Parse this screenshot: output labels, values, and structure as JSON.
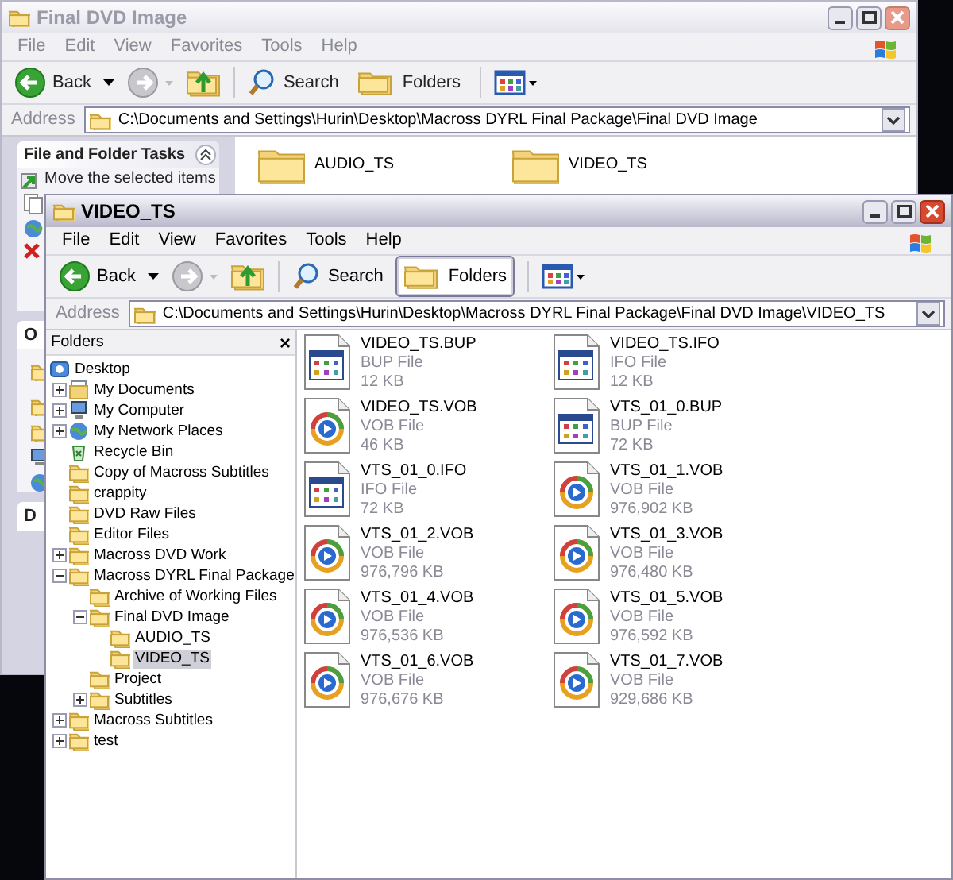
{
  "back_window": {
    "title": "Final DVD Image",
    "active": false,
    "menu": [
      "File",
      "Edit",
      "View",
      "Favorites",
      "Tools",
      "Help"
    ],
    "toolbar": {
      "back": "Back",
      "search": "Search",
      "folders": "Folders",
      "folders_pressed": false
    },
    "address": {
      "label": "Address",
      "value": "C:\\Documents and Settings\\Hurin\\Desktop\\Macross DYRL Final Package\\Final DVD Image"
    },
    "task_pane": {
      "title": "File and Folder Tasks",
      "first_task": "Move the selected items",
      "cut_headers": [
        "O",
        "D"
      ]
    },
    "items": [
      {
        "name": "AUDIO_TS"
      },
      {
        "name": "VIDEO_TS"
      }
    ]
  },
  "front_window": {
    "title": "VIDEO_TS",
    "active": true,
    "menu": [
      "File",
      "Edit",
      "View",
      "Favorites",
      "Tools",
      "Help"
    ],
    "toolbar": {
      "back": "Back",
      "search": "Search",
      "folders": "Folders",
      "folders_pressed": true
    },
    "address": {
      "label": "Address",
      "value": "C:\\Documents and Settings\\Hurin\\Desktop\\Macross DYRL Final Package\\Final DVD Image\\VIDEO_TS"
    },
    "folders_pane": {
      "title": "Folders",
      "close": "×",
      "tree": [
        {
          "label": "Desktop",
          "kind": "desktop",
          "expander": false,
          "expanded": false,
          "selected": false,
          "children": [
            {
              "label": "My Documents",
              "kind": "documents",
              "expander": true,
              "expanded": false,
              "selected": false
            },
            {
              "label": "My Computer",
              "kind": "computer",
              "expander": true,
              "expanded": false,
              "selected": false
            },
            {
              "label": "My Network Places",
              "kind": "network",
              "expander": true,
              "expanded": false,
              "selected": false
            },
            {
              "label": "Recycle Bin",
              "kind": "recycle",
              "expander": false,
              "expanded": false,
              "selected": false
            },
            {
              "label": "Copy of Macross Subtitles",
              "kind": "folder",
              "expander": false,
              "expanded": false,
              "selected": false
            },
            {
              "label": "crappity",
              "kind": "folder",
              "expander": false,
              "expanded": false,
              "selected": false
            },
            {
              "label": "DVD Raw Files",
              "kind": "folder",
              "expander": false,
              "expanded": false,
              "selected": false
            },
            {
              "label": "Editor Files",
              "kind": "folder",
              "expander": false,
              "expanded": false,
              "selected": false
            },
            {
              "label": "Macross DVD Work",
              "kind": "folder",
              "expander": true,
              "expanded": false,
              "selected": false
            },
            {
              "label": "Macross DYRL Final Package",
              "kind": "folder",
              "expander": true,
              "expanded": true,
              "selected": false,
              "children": [
                {
                  "label": "Archive of Working Files",
                  "kind": "folder",
                  "expander": false,
                  "expanded": false,
                  "selected": false
                },
                {
                  "label": "Final DVD Image",
                  "kind": "folder",
                  "expander": true,
                  "expanded": true,
                  "selected": false,
                  "children": [
                    {
                      "label": "AUDIO_TS",
                      "kind": "folder",
                      "expander": false,
                      "expanded": false,
                      "selected": false
                    },
                    {
                      "label": "VIDEO_TS",
                      "kind": "folder",
                      "expander": false,
                      "expanded": false,
                      "selected": true
                    }
                  ]
                },
                {
                  "label": "Project",
                  "kind": "folder",
                  "expander": false,
                  "expanded": false,
                  "selected": false
                },
                {
                  "label": "Subtitles",
                  "kind": "folder",
                  "expander": true,
                  "expanded": false,
                  "selected": false
                }
              ]
            },
            {
              "label": "Macross Subtitles",
              "kind": "folder",
              "expander": true,
              "expanded": false,
              "selected": false
            },
            {
              "label": "test",
              "kind": "folder",
              "expander": true,
              "expanded": false,
              "selected": false
            }
          ]
        }
      ]
    },
    "files": [
      {
        "name": "VIDEO_TS.BUP",
        "type": "BUP File",
        "size": "12 KB",
        "kind": "data"
      },
      {
        "name": "VIDEO_TS.IFO",
        "type": "IFO File",
        "size": "12 KB",
        "kind": "data"
      },
      {
        "name": "VIDEO_TS.VOB",
        "type": "VOB File",
        "size": "46 KB",
        "kind": "media"
      },
      {
        "name": "VTS_01_0.BUP",
        "type": "BUP File",
        "size": "72 KB",
        "kind": "data"
      },
      {
        "name": "VTS_01_0.IFO",
        "type": "IFO File",
        "size": "72 KB",
        "kind": "data"
      },
      {
        "name": "VTS_01_1.VOB",
        "type": "VOB File",
        "size": "976,902 KB",
        "kind": "media"
      },
      {
        "name": "VTS_01_2.VOB",
        "type": "VOB File",
        "size": "976,796 KB",
        "kind": "media"
      },
      {
        "name": "VTS_01_3.VOB",
        "type": "VOB File",
        "size": "976,480 KB",
        "kind": "media"
      },
      {
        "name": "VTS_01_4.VOB",
        "type": "VOB File",
        "size": "976,536 KB",
        "kind": "media"
      },
      {
        "name": "VTS_01_5.VOB",
        "type": "VOB File",
        "size": "976,592 KB",
        "kind": "media"
      },
      {
        "name": "VTS_01_6.VOB",
        "type": "VOB File",
        "size": "976,676 KB",
        "kind": "media"
      },
      {
        "name": "VTS_01_7.VOB",
        "type": "VOB File",
        "size": "929,686 KB",
        "kind": "media"
      }
    ]
  }
}
